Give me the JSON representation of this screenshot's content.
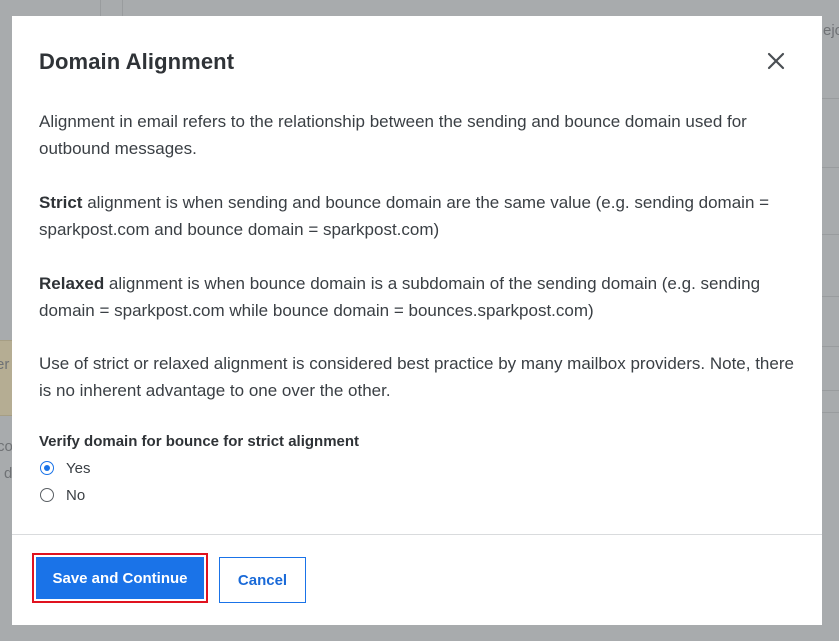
{
  "modal": {
    "title": "Domain Alignment",
    "close_icon": "close-icon",
    "paragraphs": {
      "intro": "Alignment in email refers to the relationship between the sending and bounce domain used for outbound messages.",
      "strict_term": "Strict",
      "strict_rest": " alignment is when sending and bounce domain are the same value (e.g. sending domain = sparkpost.com and bounce domain = sparkpost.com)",
      "relaxed_term": "Relaxed",
      "relaxed_rest": " alignment is when bounce domain is a subdomain of the sending domain (e.g. sending domain = sparkpost.com while bounce domain = bounces.sparkpost.com)",
      "note": "Use of strict or relaxed alignment is considered best practice by many mailbox providers. Note, there is no inherent advantage to one over the other."
    },
    "radio_group": {
      "label": "Verify domain for bounce for strict alignment",
      "options": [
        {
          "label": "Yes",
          "checked": true
        },
        {
          "label": "No",
          "checked": false
        }
      ]
    },
    "footer": {
      "save_label": "Save and Continue",
      "cancel_label": "Cancel"
    }
  },
  "background": {
    "fragments": [
      "ejo",
      "er",
      "co",
      "d"
    ]
  },
  "colors": {
    "primary": "#1a73e8",
    "highlight_outline": "#e0121f",
    "overlay": "#a8abad",
    "text": "#3a3f44"
  }
}
